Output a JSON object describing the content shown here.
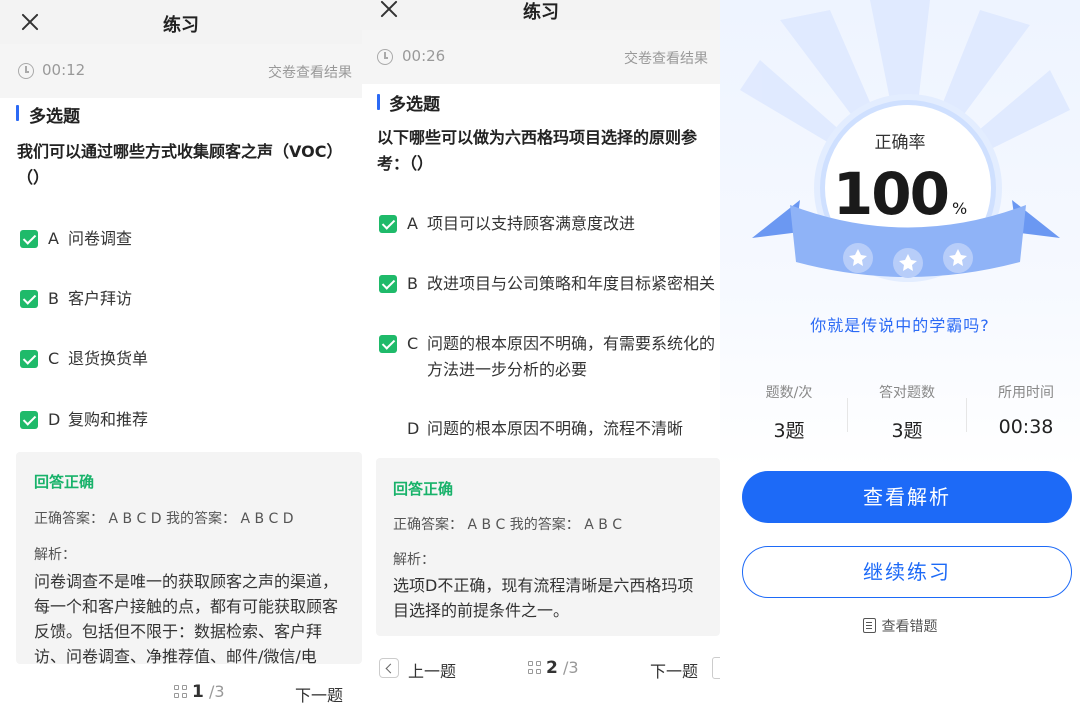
{
  "panel1": {
    "title": "练习",
    "timer": "00:12",
    "submit_link": "交卷查看结果",
    "question_type": "多选题",
    "question_lines": [
      "我们可以通过哪些方式收集顾客之声（VOC）",
      "（）"
    ],
    "options": [
      {
        "letter": "A",
        "text": "问卷调查",
        "checked": true
      },
      {
        "letter": "B",
        "text": "客户拜访",
        "checked": true
      },
      {
        "letter": "C",
        "text": "退货换货单",
        "checked": true
      },
      {
        "letter": "D",
        "text": "复购和推荐",
        "checked": true
      }
    ],
    "result_label": "回答正确",
    "answer_line": "正确答案：  A B C D    我的答案：  A B C D",
    "analysis_label": "解析：",
    "analysis_lines": [
      "问卷调查不是唯一的获取顾客之声的渠道，",
      "每一个和客户接触的点，都有可能获取顾客",
      "反馈。包括但不限于：数据检索、客户拜",
      "访、问卷调查、净推荐值、邮件/微信/电"
    ],
    "page_current": "1",
    "page_total": "/3",
    "next_label": "下一题"
  },
  "panel2": {
    "title": "练习",
    "timer": "00:26",
    "submit_link": "交卷查看结果",
    "question_type": "多选题",
    "question_lines": [
      "以下哪些可以做为六西格玛项目选择的原则参",
      "考：（）"
    ],
    "options": [
      {
        "letter": "A",
        "lines": [
          "项目可以支持顾客满意度改进"
        ],
        "checked": true
      },
      {
        "letter": "B",
        "lines": [
          "改进项目与公司策略和年度目标紧密相关"
        ],
        "checked": true
      },
      {
        "letter": "C",
        "lines": [
          "问题的根本原因不明确，有需要系统化的",
          "方法进一步分析的必要"
        ],
        "checked": true
      },
      {
        "letter": "D",
        "lines": [
          "问题的根本原因不明确，流程不清晰"
        ],
        "checked": false
      }
    ],
    "result_label": "回答正确",
    "answer_line": "正确答案：  A B C    我的答案：  A B C",
    "analysis_label": "解析：",
    "analysis_lines": [
      "选项D不正确，现有流程清晰是六西格玛项",
      "目选择的前提条件之一。"
    ],
    "prev_label": "上一题",
    "page_current": "2",
    "page_total": "/3",
    "next_label": "下一题"
  },
  "result": {
    "rate_label": "正确率",
    "rate_value": "100",
    "rate_unit": "%",
    "slogan": "你就是传说中的学霸吗?",
    "stats": [
      {
        "label": "题数/次",
        "value": "3题"
      },
      {
        "label": "答对题数",
        "value": "3题"
      },
      {
        "label": "所用时间",
        "value": "00:38"
      }
    ],
    "view_analysis_label": "查看解析",
    "continue_label": "继续练习",
    "view_errors_label": "查看错题"
  }
}
